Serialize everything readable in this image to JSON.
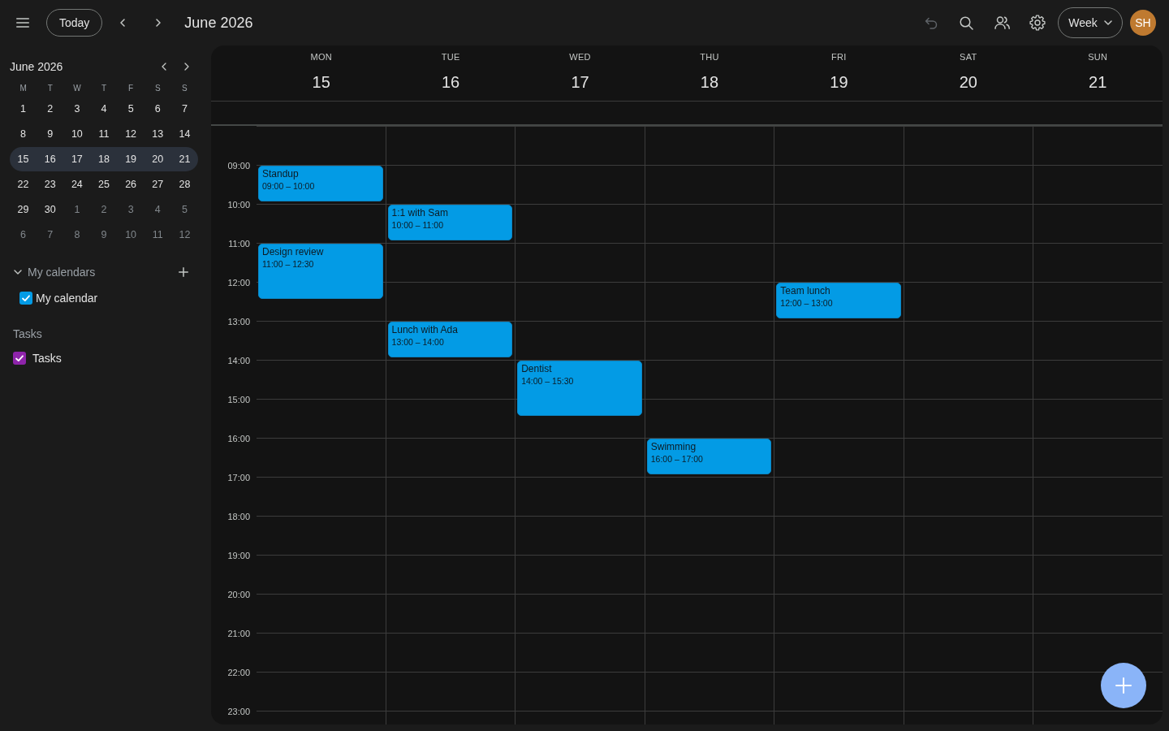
{
  "toolbar": {
    "today": "Today",
    "title": "June 2026",
    "undo": {
      "disabled": true
    },
    "view": "Week",
    "avatar": "SH"
  },
  "mini_calendar": {
    "title": "June 2026",
    "weekdays": [
      "M",
      "T",
      "W",
      "T",
      "F",
      "S",
      "S"
    ],
    "weeks": [
      {
        "selected": false,
        "days": [
          {
            "label": "1",
            "outside": false
          },
          {
            "label": "2",
            "outside": false
          },
          {
            "label": "3",
            "outside": false
          },
          {
            "label": "4",
            "outside": false
          },
          {
            "label": "5",
            "outside": false
          },
          {
            "label": "6",
            "outside": false
          },
          {
            "label": "7",
            "outside": false
          }
        ]
      },
      {
        "selected": false,
        "days": [
          {
            "label": "8",
            "outside": false
          },
          {
            "label": "9",
            "outside": false
          },
          {
            "label": "10",
            "outside": false
          },
          {
            "label": "11",
            "outside": false
          },
          {
            "label": "12",
            "outside": false
          },
          {
            "label": "13",
            "outside": false
          },
          {
            "label": "14",
            "outside": false
          }
        ]
      },
      {
        "selected": true,
        "days": [
          {
            "label": "15",
            "outside": false
          },
          {
            "label": "16",
            "outside": false
          },
          {
            "label": "17",
            "outside": false
          },
          {
            "label": "18",
            "outside": false
          },
          {
            "label": "19",
            "outside": false
          },
          {
            "label": "20",
            "outside": false
          },
          {
            "label": "21",
            "outside": false
          }
        ]
      },
      {
        "selected": false,
        "days": [
          {
            "label": "22",
            "outside": false
          },
          {
            "label": "23",
            "outside": false
          },
          {
            "label": "24",
            "outside": false
          },
          {
            "label": "25",
            "outside": false
          },
          {
            "label": "26",
            "outside": false
          },
          {
            "label": "27",
            "outside": false
          },
          {
            "label": "28",
            "outside": false
          }
        ]
      },
      {
        "selected": false,
        "days": [
          {
            "label": "29",
            "outside": false
          },
          {
            "label": "30",
            "outside": false
          },
          {
            "label": "1",
            "outside": true
          },
          {
            "label": "2",
            "outside": true
          },
          {
            "label": "3",
            "outside": true
          },
          {
            "label": "4",
            "outside": true
          },
          {
            "label": "5",
            "outside": true
          }
        ]
      },
      {
        "selected": false,
        "days": [
          {
            "label": "6",
            "outside": true
          },
          {
            "label": "7",
            "outside": true
          },
          {
            "label": "8",
            "outside": true
          },
          {
            "label": "9",
            "outside": true
          },
          {
            "label": "10",
            "outside": true
          },
          {
            "label": "11",
            "outside": true
          },
          {
            "label": "12",
            "outside": true
          }
        ]
      }
    ]
  },
  "my_calendars": {
    "title": "My calendars",
    "expanded": true,
    "items": [
      {
        "label": "My calendar",
        "checked": true,
        "color": "#039be5"
      }
    ]
  },
  "tasks": {
    "title": "Tasks",
    "items": [
      {
        "label": "Tasks",
        "checked": true,
        "color": "#8e24aa"
      }
    ]
  },
  "week": {
    "days": [
      {
        "weekday": "MON",
        "date": "15",
        "events": [
          {
            "title": "Standup",
            "time": "09:00 – 10:00"
          },
          {
            "title": "Design review",
            "time": "11:00 – 12:30"
          }
        ]
      },
      {
        "weekday": "TUE",
        "date": "16",
        "events": [
          {
            "title": "1:1 with Sam",
            "time": "10:00 – 11:00"
          },
          {
            "title": "Lunch with Ada",
            "time": "13:00 – 14:00"
          }
        ]
      },
      {
        "weekday": "WED",
        "date": "17",
        "events": [
          {
            "title": "Dentist",
            "time": "14:00 – 15:30"
          }
        ]
      },
      {
        "weekday": "THU",
        "date": "18",
        "events": [
          {
            "title": "Swimming",
            "time": "16:00 – 17:00"
          }
        ]
      },
      {
        "weekday": "FRI",
        "date": "19",
        "events": [
          {
            "title": "Team lunch",
            "time": "12:00 – 13:00"
          }
        ]
      },
      {
        "weekday": "SAT",
        "date": "20"
      },
      {
        "weekday": "SUN",
        "date": "21"
      }
    ],
    "hours": [
      "09:00",
      "10:00",
      "11:00",
      "12:00",
      "13:00",
      "14:00",
      "15:00",
      "16:00",
      "17:00",
      "18:00",
      "19:00",
      "20:00",
      "21:00",
      "22:00",
      "23:00"
    ]
  }
}
